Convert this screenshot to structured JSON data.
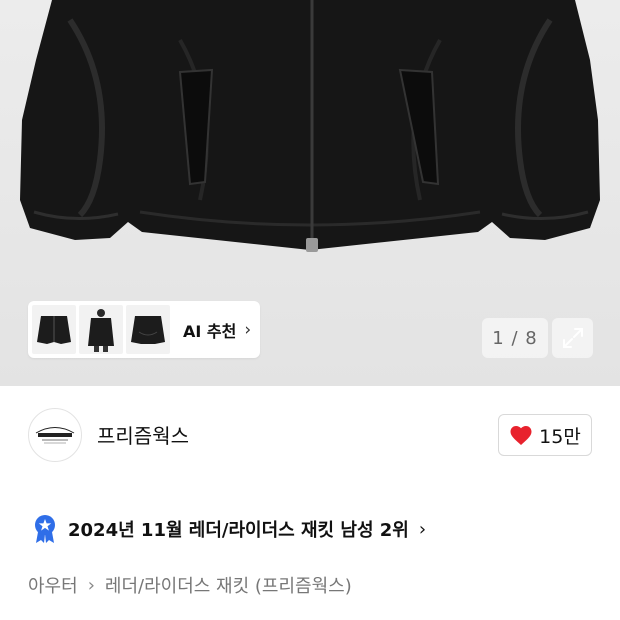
{
  "gallery": {
    "ai_label": "AI 추천",
    "page_counter": "1 / 8",
    "thumbnails": [
      "jacket-front-thumbnail",
      "jacket-model-thumbnail",
      "jacket-back-thumbnail"
    ]
  },
  "brand": {
    "name": "프리즘웍스",
    "logo_text": "PRIZMWORKS",
    "like_count": "15만"
  },
  "ranking": {
    "text": "2024년 11월 레더/라이더스 재킷 남성 2위"
  },
  "breadcrumb": {
    "category": "아우터",
    "subcategory": "레더/라이더스 재킷 (프리즘웍스)"
  },
  "colors": {
    "heart": "#e8222d",
    "badge": "#2f6ee8",
    "hero_bg": "#e6e6e6"
  }
}
